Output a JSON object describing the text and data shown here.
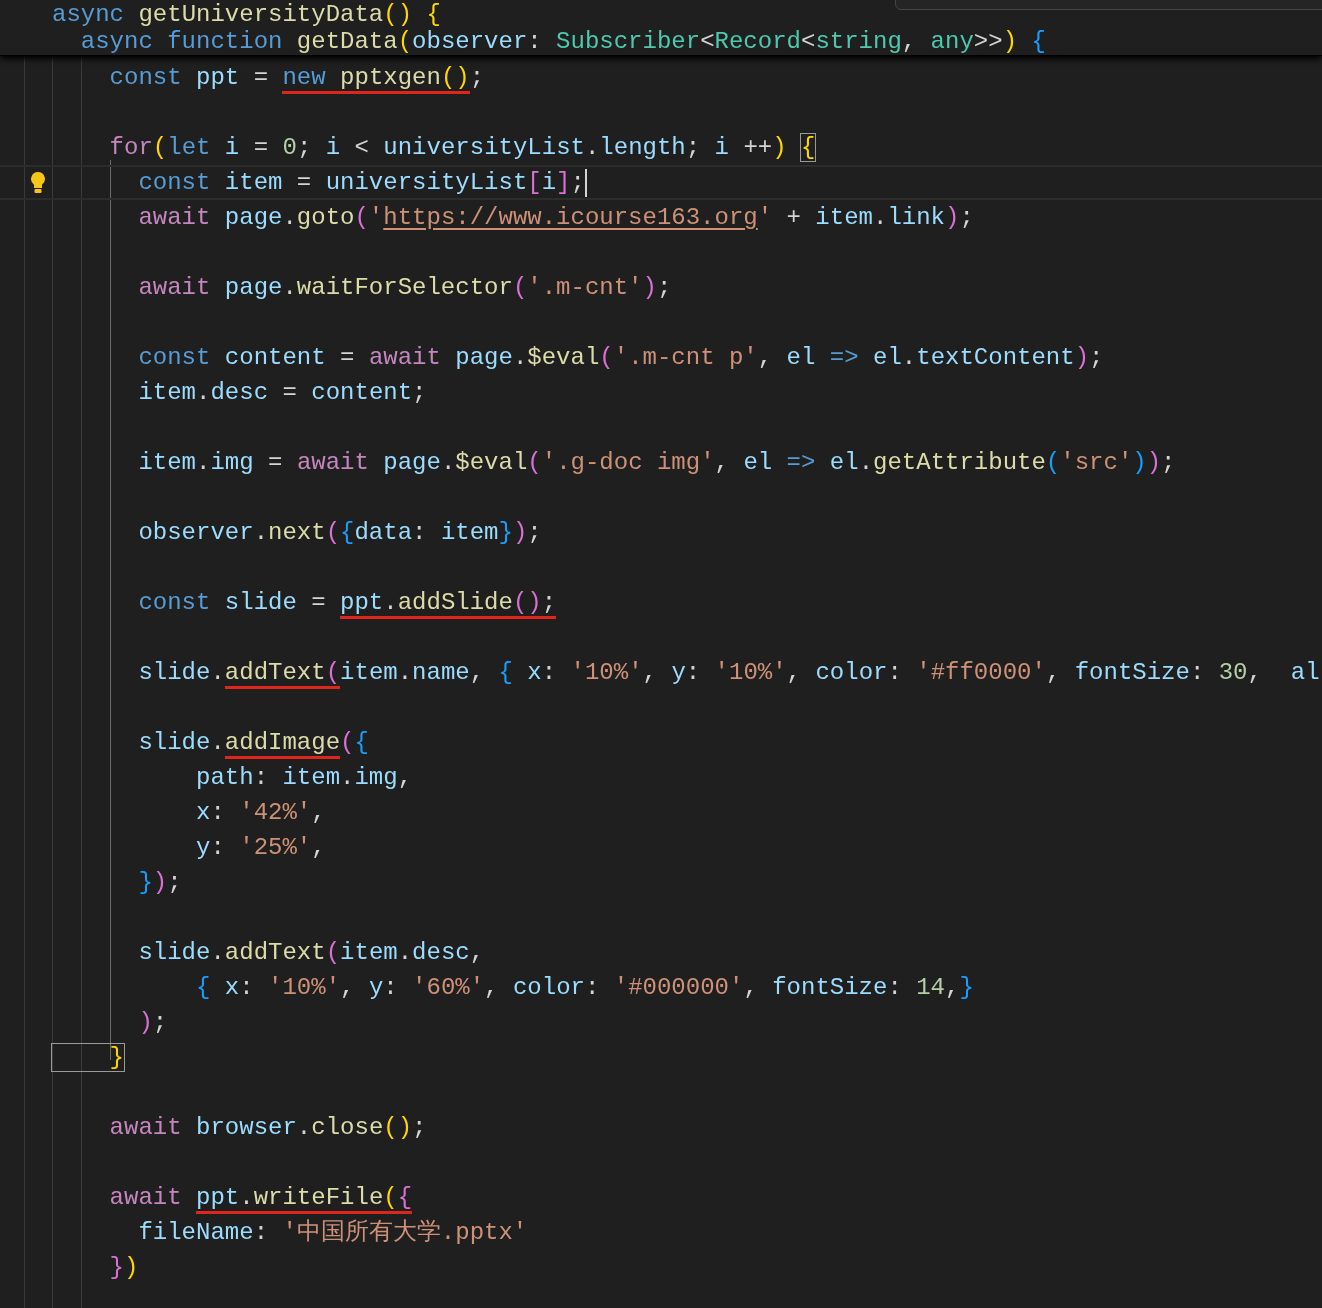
{
  "sticky_lines": [
    {
      "tokens": [
        {
          "text": "async ",
          "color": "#569cd6"
        },
        {
          "text": "getUniversityData",
          "color": "#dcdcaa"
        },
        {
          "text": "(",
          "color": "#ffd700"
        },
        {
          "text": ") ",
          "color": "#ffd700"
        },
        {
          "text": "{",
          "color": "#ffd700"
        }
      ]
    },
    {
      "tokens": [
        {
          "text": "  async ",
          "color": "#569cd6"
        },
        {
          "text": "function ",
          "color": "#569cd6"
        },
        {
          "text": "getData",
          "color": "#dcdcaa"
        },
        {
          "text": "(",
          "color": "#ffd700"
        },
        {
          "text": "observer",
          "color": "#9cdcfe"
        },
        {
          "text": ": "
        },
        {
          "text": "Subscriber",
          "color": "#4ec9b0"
        },
        {
          "text": "<"
        },
        {
          "text": "Record",
          "color": "#4ec9b0"
        },
        {
          "text": "<"
        },
        {
          "text": "string",
          "color": "#4ec9b0"
        },
        {
          "text": ", "
        },
        {
          "text": "any",
          "color": "#4ec9b0"
        },
        {
          "text": ">>"
        },
        {
          "text": ") ",
          "color": "#ffd700"
        },
        {
          "text": "{",
          "color": "#179fff"
        }
      ]
    }
  ],
  "lines": [
    {
      "kind": "code",
      "tokens": [
        {
          "text": "    const ",
          "color": "#569cd6"
        },
        {
          "text": "ppt",
          "color": "#9cdcfe"
        },
        {
          "text": " = "
        },
        {
          "text": "new ",
          "color": "#569cd6",
          "mark": true
        },
        {
          "text": "pptxgen",
          "color": "#dcdcaa",
          "mark": true
        },
        {
          "text": "(",
          "color": "#ffd700",
          "mark": true
        },
        {
          "text": ")",
          "color": "#ffd700",
          "mark": true
        },
        {
          "text": ";"
        }
      ]
    },
    {
      "kind": "blank"
    },
    {
      "kind": "code",
      "tokens": [
        {
          "text": "    for",
          "color": "#c586c0"
        },
        {
          "text": "(",
          "color": "#ffd700"
        },
        {
          "text": "let ",
          "color": "#569cd6"
        },
        {
          "text": "i",
          "color": "#9cdcfe"
        },
        {
          "text": " = "
        },
        {
          "text": "0",
          "color": "#b5cea8"
        },
        {
          "text": "; "
        },
        {
          "text": "i",
          "color": "#9cdcfe"
        },
        {
          "text": " < "
        },
        {
          "text": "universityList",
          "color": "#9cdcfe"
        },
        {
          "text": "."
        },
        {
          "text": "length",
          "color": "#9cdcfe"
        },
        {
          "text": "; "
        },
        {
          "text": "i",
          "color": "#9cdcfe"
        },
        {
          "text": " ++"
        },
        {
          "text": ") ",
          "color": "#ffd700"
        },
        {
          "text": "{",
          "color": "#ffd700",
          "match": true
        }
      ]
    },
    {
      "kind": "code",
      "current": true,
      "tokens": [
        {
          "text": "      const ",
          "color": "#569cd6"
        },
        {
          "text": "item",
          "color": "#9cdcfe"
        },
        {
          "text": " = "
        },
        {
          "text": "universityList",
          "color": "#9cdcfe"
        },
        {
          "text": "[",
          "color": "#da70d6"
        },
        {
          "text": "i",
          "color": "#9cdcfe"
        },
        {
          "text": "]",
          "color": "#da70d6"
        },
        {
          "text": ";"
        }
      ]
    },
    {
      "kind": "code",
      "tokens": [
        {
          "text": "      await ",
          "color": "#c586c0"
        },
        {
          "text": "page",
          "color": "#9cdcfe"
        },
        {
          "text": "."
        },
        {
          "text": "goto",
          "color": "#dcdcaa"
        },
        {
          "text": "(",
          "color": "#da70d6"
        },
        {
          "text": "'",
          "color": "#ce9178"
        },
        {
          "text": "https://www.icourse163.org",
          "color": "#ce9178",
          "link": true
        },
        {
          "text": "'",
          "color": "#ce9178"
        },
        {
          "text": " + "
        },
        {
          "text": "item",
          "color": "#9cdcfe"
        },
        {
          "text": "."
        },
        {
          "text": "link",
          "color": "#9cdcfe"
        },
        {
          "text": ")",
          "color": "#da70d6"
        },
        {
          "text": ";"
        }
      ]
    },
    {
      "kind": "blank"
    },
    {
      "kind": "code",
      "tokens": [
        {
          "text": "      await ",
          "color": "#c586c0"
        },
        {
          "text": "page",
          "color": "#9cdcfe"
        },
        {
          "text": "."
        },
        {
          "text": "waitForSelector",
          "color": "#dcdcaa"
        },
        {
          "text": "(",
          "color": "#da70d6"
        },
        {
          "text": "'.m-cnt'",
          "color": "#ce9178"
        },
        {
          "text": ")",
          "color": "#da70d6"
        },
        {
          "text": ";"
        }
      ]
    },
    {
      "kind": "blank"
    },
    {
      "kind": "code",
      "tokens": [
        {
          "text": "      const ",
          "color": "#569cd6"
        },
        {
          "text": "content",
          "color": "#9cdcfe"
        },
        {
          "text": " = "
        },
        {
          "text": "await ",
          "color": "#c586c0"
        },
        {
          "text": "page",
          "color": "#9cdcfe"
        },
        {
          "text": "."
        },
        {
          "text": "$eval",
          "color": "#dcdcaa"
        },
        {
          "text": "(",
          "color": "#da70d6"
        },
        {
          "text": "'.m-cnt p'",
          "color": "#ce9178"
        },
        {
          "text": ", "
        },
        {
          "text": "el ",
          "color": "#9cdcfe"
        },
        {
          "text": "=> ",
          "color": "#569cd6"
        },
        {
          "text": "el",
          "color": "#9cdcfe"
        },
        {
          "text": "."
        },
        {
          "text": "textContent",
          "color": "#9cdcfe"
        },
        {
          "text": ")",
          "color": "#da70d6"
        },
        {
          "text": ";"
        }
      ]
    },
    {
      "kind": "code",
      "tokens": [
        {
          "text": "      item",
          "color": "#9cdcfe"
        },
        {
          "text": "."
        },
        {
          "text": "desc",
          "color": "#9cdcfe"
        },
        {
          "text": " = "
        },
        {
          "text": "content",
          "color": "#9cdcfe"
        },
        {
          "text": ";"
        }
      ]
    },
    {
      "kind": "blank"
    },
    {
      "kind": "code",
      "tokens": [
        {
          "text": "      item",
          "color": "#9cdcfe"
        },
        {
          "text": "."
        },
        {
          "text": "img",
          "color": "#9cdcfe"
        },
        {
          "text": " = "
        },
        {
          "text": "await ",
          "color": "#c586c0"
        },
        {
          "text": "page",
          "color": "#9cdcfe"
        },
        {
          "text": "."
        },
        {
          "text": "$eval",
          "color": "#dcdcaa"
        },
        {
          "text": "(",
          "color": "#da70d6"
        },
        {
          "text": "'.g-doc img'",
          "color": "#ce9178"
        },
        {
          "text": ", "
        },
        {
          "text": "el ",
          "color": "#9cdcfe"
        },
        {
          "text": "=> ",
          "color": "#569cd6"
        },
        {
          "text": "el",
          "color": "#9cdcfe"
        },
        {
          "text": "."
        },
        {
          "text": "getAttribute",
          "color": "#dcdcaa"
        },
        {
          "text": "(",
          "color": "#179fff"
        },
        {
          "text": "'src'",
          "color": "#ce9178"
        },
        {
          "text": ")",
          "color": "#179fff"
        },
        {
          "text": ")",
          "color": "#da70d6"
        },
        {
          "text": ";"
        }
      ]
    },
    {
      "kind": "blank"
    },
    {
      "kind": "code",
      "tokens": [
        {
          "text": "      observer",
          "color": "#9cdcfe"
        },
        {
          "text": "."
        },
        {
          "text": "next",
          "color": "#dcdcaa"
        },
        {
          "text": "(",
          "color": "#da70d6"
        },
        {
          "text": "{",
          "color": "#179fff"
        },
        {
          "text": "data",
          "color": "#9cdcfe"
        },
        {
          "text": ": "
        },
        {
          "text": "item",
          "color": "#9cdcfe"
        },
        {
          "text": "}",
          "color": "#179fff"
        },
        {
          "text": ")",
          "color": "#da70d6"
        },
        {
          "text": ";"
        }
      ]
    },
    {
      "kind": "blank"
    },
    {
      "kind": "code",
      "tokens": [
        {
          "text": "      const ",
          "color": "#569cd6"
        },
        {
          "text": "slide",
          "color": "#9cdcfe"
        },
        {
          "text": " = "
        },
        {
          "text": "ppt",
          "color": "#9cdcfe",
          "mark": true
        },
        {
          "text": ".",
          "mark": true
        },
        {
          "text": "addSlide",
          "color": "#dcdcaa",
          "mark": true
        },
        {
          "text": "(",
          "color": "#da70d6",
          "mark": true
        },
        {
          "text": ")",
          "color": "#da70d6",
          "mark": true
        },
        {
          "text": ";",
          "mark": true
        }
      ]
    },
    {
      "kind": "blank"
    },
    {
      "kind": "code",
      "tokens": [
        {
          "text": "      slide",
          "color": "#9cdcfe"
        },
        {
          "text": "."
        },
        {
          "text": "addText",
          "color": "#dcdcaa",
          "mark": true
        },
        {
          "text": "(",
          "color": "#da70d6",
          "mark": true
        },
        {
          "text": "item",
          "color": "#9cdcfe"
        },
        {
          "text": "."
        },
        {
          "text": "name",
          "color": "#9cdcfe"
        },
        {
          "text": ", "
        },
        {
          "text": "{ ",
          "color": "#179fff"
        },
        {
          "text": "x",
          "color": "#9cdcfe"
        },
        {
          "text": ": "
        },
        {
          "text": "'10%'",
          "color": "#ce9178"
        },
        {
          "text": ", "
        },
        {
          "text": "y",
          "color": "#9cdcfe"
        },
        {
          "text": ": "
        },
        {
          "text": "'10%'",
          "color": "#ce9178"
        },
        {
          "text": ", "
        },
        {
          "text": "color",
          "color": "#9cdcfe"
        },
        {
          "text": ": "
        },
        {
          "text": "'#ff0000'",
          "color": "#ce9178"
        },
        {
          "text": ", "
        },
        {
          "text": "fontSize",
          "color": "#9cdcfe"
        },
        {
          "text": ": "
        },
        {
          "text": "30",
          "color": "#b5cea8"
        },
        {
          "text": ",  "
        },
        {
          "text": "al",
          "color": "#9cdcfe"
        }
      ]
    },
    {
      "kind": "blank"
    },
    {
      "kind": "code",
      "tokens": [
        {
          "text": "      slide",
          "color": "#9cdcfe"
        },
        {
          "text": "."
        },
        {
          "text": "addImage",
          "color": "#dcdcaa",
          "mark": true
        },
        {
          "text": "(",
          "color": "#da70d6"
        },
        {
          "text": "{",
          "color": "#179fff"
        }
      ]
    },
    {
      "kind": "code",
      "tokens": [
        {
          "text": "          path",
          "color": "#9cdcfe"
        },
        {
          "text": ": "
        },
        {
          "text": "item",
          "color": "#9cdcfe"
        },
        {
          "text": "."
        },
        {
          "text": "img",
          "color": "#9cdcfe"
        },
        {
          "text": ","
        }
      ]
    },
    {
      "kind": "code",
      "tokens": [
        {
          "text": "          x",
          "color": "#9cdcfe"
        },
        {
          "text": ": "
        },
        {
          "text": "'42%'",
          "color": "#ce9178"
        },
        {
          "text": ","
        }
      ]
    },
    {
      "kind": "code",
      "tokens": [
        {
          "text": "          y",
          "color": "#9cdcfe"
        },
        {
          "text": ": "
        },
        {
          "text": "'25%'",
          "color": "#ce9178"
        },
        {
          "text": ","
        }
      ]
    },
    {
      "kind": "code",
      "tokens": [
        {
          "text": "      }",
          "color": "#179fff"
        },
        {
          "text": ")",
          "color": "#da70d6"
        },
        {
          "text": ";"
        }
      ]
    },
    {
      "kind": "blank"
    },
    {
      "kind": "code",
      "tokens": [
        {
          "text": "      slide",
          "color": "#9cdcfe"
        },
        {
          "text": "."
        },
        {
          "text": "addText",
          "color": "#dcdcaa"
        },
        {
          "text": "(",
          "color": "#da70d6"
        },
        {
          "text": "item",
          "color": "#9cdcfe"
        },
        {
          "text": "."
        },
        {
          "text": "desc",
          "color": "#9cdcfe"
        },
        {
          "text": ","
        }
      ]
    },
    {
      "kind": "code",
      "tokens": [
        {
          "text": "          { ",
          "color": "#179fff"
        },
        {
          "text": "x",
          "color": "#9cdcfe"
        },
        {
          "text": ": "
        },
        {
          "text": "'10%'",
          "color": "#ce9178"
        },
        {
          "text": ", "
        },
        {
          "text": "y",
          "color": "#9cdcfe"
        },
        {
          "text": ": "
        },
        {
          "text": "'60%'",
          "color": "#ce9178"
        },
        {
          "text": ", "
        },
        {
          "text": "color",
          "color": "#9cdcfe"
        },
        {
          "text": ": "
        },
        {
          "text": "'#000000'",
          "color": "#ce9178"
        },
        {
          "text": ", "
        },
        {
          "text": "fontSize",
          "color": "#9cdcfe"
        },
        {
          "text": ": "
        },
        {
          "text": "14",
          "color": "#b5cea8"
        },
        {
          "text": ","
        },
        {
          "text": "}",
          "color": "#179fff"
        }
      ]
    },
    {
      "kind": "code",
      "tokens": [
        {
          "text": "      )",
          "color": "#da70d6"
        },
        {
          "text": ";"
        }
      ]
    },
    {
      "kind": "code",
      "tokens": [
        {
          "text": "    }",
          "color": "#ffd700",
          "match": true
        }
      ]
    },
    {
      "kind": "blank"
    },
    {
      "kind": "code",
      "tokens": [
        {
          "text": "    await ",
          "color": "#c586c0"
        },
        {
          "text": "browser",
          "color": "#9cdcfe"
        },
        {
          "text": "."
        },
        {
          "text": "close",
          "color": "#dcdcaa"
        },
        {
          "text": "(",
          "color": "#ffd700"
        },
        {
          "text": ")",
          "color": "#ffd700"
        },
        {
          "text": ";"
        }
      ]
    },
    {
      "kind": "blank"
    },
    {
      "kind": "code",
      "tokens": [
        {
          "text": "    await ",
          "color": "#c586c0"
        },
        {
          "text": "ppt",
          "color": "#9cdcfe",
          "mark": true
        },
        {
          "text": ".",
          "mark": true
        },
        {
          "text": "writeFile",
          "color": "#dcdcaa",
          "mark": true
        },
        {
          "text": "(",
          "color": "#ffd700",
          "mark": true
        },
        {
          "text": "{",
          "color": "#da70d6",
          "mark": true
        }
      ]
    },
    {
      "kind": "code",
      "tokens": [
        {
          "text": "      fileName",
          "color": "#9cdcfe"
        },
        {
          "text": ": "
        },
        {
          "text": "'中国所有大学.pptx'",
          "color": "#ce9178"
        }
      ]
    },
    {
      "kind": "code",
      "tokens": [
        {
          "text": "    }",
          "color": "#da70d6"
        },
        {
          "text": ")",
          "color": "#ffd700"
        }
      ]
    }
  ]
}
